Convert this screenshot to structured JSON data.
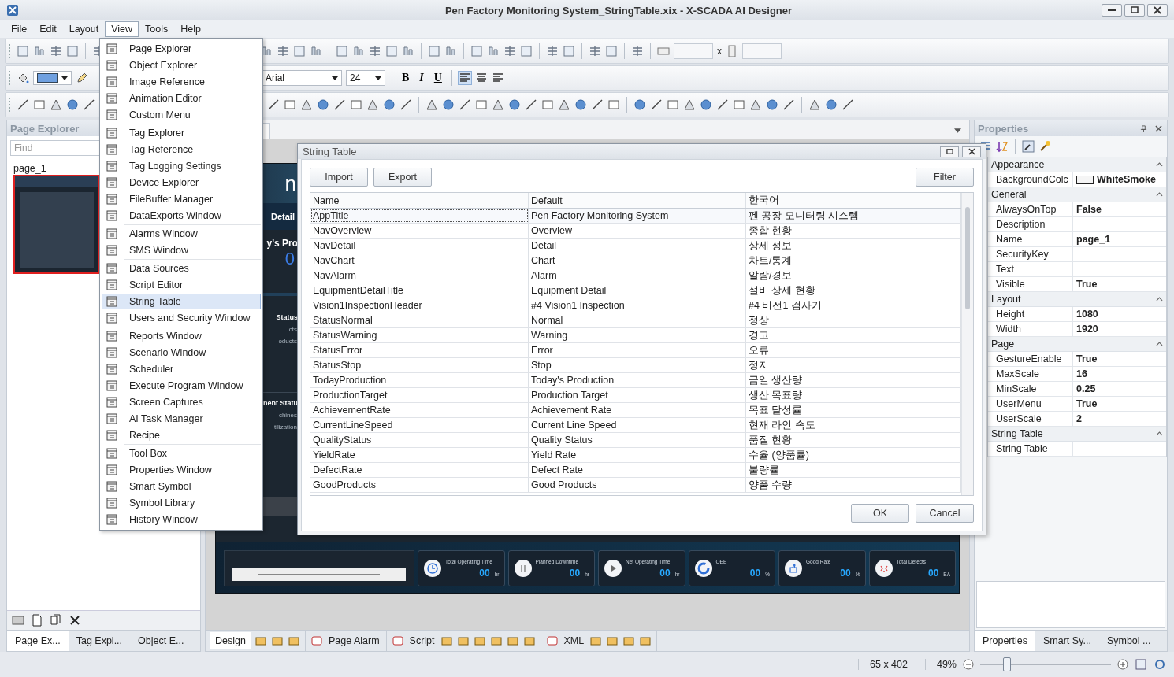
{
  "window": {
    "title": "Pen Factory Monitoring System_StringTable.xix - X-SCADA AI Designer"
  },
  "menu": [
    {
      "label": "File",
      "selected": false
    },
    {
      "label": "Edit",
      "selected": false
    },
    {
      "label": "Layout",
      "selected": false
    },
    {
      "label": "View",
      "selected": true
    },
    {
      "label": "Tools",
      "selected": false
    },
    {
      "label": "Help",
      "selected": false
    }
  ],
  "view_menu": {
    "groups": [
      [
        {
          "label": "Page Explorer",
          "selected": false
        },
        {
          "label": "Object Explorer",
          "selected": false
        },
        {
          "label": "Image Reference",
          "selected": false
        },
        {
          "label": "Animation Editor",
          "selected": false
        },
        {
          "label": "Custom Menu",
          "selected": false
        }
      ],
      [
        {
          "label": "Tag Explorer",
          "selected": false
        },
        {
          "label": "Tag Reference",
          "selected": false
        },
        {
          "label": "Tag Logging Settings",
          "selected": false
        },
        {
          "label": "Device Explorer",
          "selected": false
        },
        {
          "label": "FileBuffer Manager",
          "selected": false
        },
        {
          "label": "DataExports Window",
          "selected": false
        }
      ],
      [
        {
          "label": "Alarms Window",
          "selected": false
        },
        {
          "label": "SMS Window",
          "selected": false
        }
      ],
      [
        {
          "label": "Data Sources",
          "selected": false
        },
        {
          "label": "Script Editor",
          "selected": false
        },
        {
          "label": "String Table",
          "selected": true
        },
        {
          "label": "Users and Security Window",
          "selected": false
        }
      ],
      [
        {
          "label": "Reports Window",
          "selected": false
        },
        {
          "label": "Scenario Window",
          "selected": false
        },
        {
          "label": "Scheduler",
          "selected": false
        },
        {
          "label": "Execute Program Window",
          "selected": false
        },
        {
          "label": "Screen Captures",
          "selected": false
        },
        {
          "label": "AI Task Manager",
          "selected": false
        },
        {
          "label": "Recipe",
          "selected": false
        }
      ],
      [
        {
          "label": "Tool Box",
          "selected": false
        },
        {
          "label": "Properties Window",
          "selected": false
        },
        {
          "label": "Smart Symbol",
          "selected": false
        },
        {
          "label": "Symbol Library",
          "selected": false
        },
        {
          "label": "History Window",
          "selected": false
        }
      ]
    ]
  },
  "toolbar": {
    "size_separator": "x",
    "font": "Arial",
    "font_size": "24",
    "format_buttons": [
      "B",
      "I",
      "U"
    ]
  },
  "page_explorer": {
    "title": "Page Explorer",
    "find_placeholder": "Find",
    "pages": [
      {
        "label": "page_1",
        "selected": true
      }
    ],
    "tabs": [
      {
        "label": "Page Ex...",
        "selected": true
      },
      {
        "label": "Tag Expl...",
        "selected": false
      },
      {
        "label": "Object E...",
        "selected": false
      }
    ]
  },
  "design_page": {
    "title_fragment": "n",
    "nav_fragment": "Detail",
    "production_heading": "y's Pro",
    "production_value": "0",
    "status_heading": "Status",
    "status_lines": [
      "cts",
      "oducts"
    ],
    "equipment_heading": "nent Statu",
    "equipment_lines": [
      "chines",
      "tilization"
    ],
    "kpis": [
      {
        "title": "Total Operating Time",
        "value": "00",
        "unit": "hr"
      },
      {
        "title": "Planned Downtime",
        "value": "00",
        "unit": "hr"
      },
      {
        "title": "Net Operating Time",
        "value": "00",
        "unit": "hr"
      },
      {
        "title": "OEE",
        "value": "00",
        "unit": "%"
      },
      {
        "title": "Good Rate",
        "value": "00",
        "unit": "%"
      },
      {
        "title": "Total Defects",
        "value": "00",
        "unit": "EA"
      }
    ]
  },
  "string_table": {
    "title": "String Table",
    "buttons": [
      "Import",
      "Export"
    ],
    "filter": "Filter",
    "columns": [
      "Name",
      "Default",
      "한국어"
    ],
    "rows": [
      {
        "cells": [
          "AppTitle",
          "Pen Factory Monitoring System",
          "펜 공장 모니터링 시스템"
        ],
        "selected": true
      },
      {
        "cells": [
          "NavOverview",
          "Overview",
          "종합 현황"
        ],
        "selected": false
      },
      {
        "cells": [
          "NavDetail",
          "Detail",
          "상세 정보"
        ],
        "selected": false
      },
      {
        "cells": [
          "NavChart",
          "Chart",
          "차트/통계"
        ],
        "selected": false
      },
      {
        "cells": [
          "NavAlarm",
          "Alarm",
          "알람/경보"
        ],
        "selected": false
      },
      {
        "cells": [
          "EquipmentDetailTitle",
          "Equipment Detail",
          "설비 상세 현황"
        ],
        "selected": false
      },
      {
        "cells": [
          "Vision1InspectionHeader",
          "#4 Vision1 Inspection",
          "#4 비전1 검사기"
        ],
        "selected": false
      },
      {
        "cells": [
          "StatusNormal",
          "Normal",
          "정상"
        ],
        "selected": false
      },
      {
        "cells": [
          "StatusWarning",
          "Warning",
          "경고"
        ],
        "selected": false
      },
      {
        "cells": [
          "StatusError",
          "Error",
          "오류"
        ],
        "selected": false
      },
      {
        "cells": [
          "StatusStop",
          "Stop",
          "정지"
        ],
        "selected": false
      },
      {
        "cells": [
          "TodayProduction",
          "Today's Production",
          "금일 생산량"
        ],
        "selected": false
      },
      {
        "cells": [
          "ProductionTarget",
          "Production Target",
          "생산 목표량"
        ],
        "selected": false
      },
      {
        "cells": [
          "AchievementRate",
          "Achievement Rate",
          "목표 달성률"
        ],
        "selected": false
      },
      {
        "cells": [
          "CurrentLineSpeed",
          "Current Line Speed",
          "현재 라인 속도"
        ],
        "selected": false
      },
      {
        "cells": [
          "QualityStatus",
          "Quality Status",
          "품질 현황"
        ],
        "selected": false
      },
      {
        "cells": [
          "YieldRate",
          "Yield Rate",
          "수율 (양품률)"
        ],
        "selected": false
      },
      {
        "cells": [
          "DefectRate",
          "Defect Rate",
          "불량률"
        ],
        "selected": false
      },
      {
        "cells": [
          "GoodProducts",
          "Good Products",
          "양품 수량"
        ],
        "selected": false
      }
    ],
    "ok": "OK",
    "cancel": "Cancel"
  },
  "document_tabs": [
    {
      "label": "Design",
      "selected": true
    },
    {
      "label": "Page Alarm",
      "selected": false
    },
    {
      "label": "Script",
      "selected": false
    },
    {
      "label": "XML",
      "selected": false
    }
  ],
  "properties": {
    "title": "Properties",
    "categories": [
      {
        "name": "Appearance",
        "expanded": true,
        "items": [
          {
            "name": "BackgroundColc",
            "value": "WhiteSmoke",
            "kind": "color"
          }
        ]
      },
      {
        "name": "General",
        "expanded": true,
        "items": [
          {
            "name": "AlwaysOnTop",
            "value": "False",
            "kind": "text"
          },
          {
            "name": "Description",
            "kind": "text"
          },
          {
            "name": "Name",
            "value": "page_1",
            "kind": "text"
          },
          {
            "name": "SecurityKey",
            "kind": "text"
          },
          {
            "name": "Text",
            "kind": "text"
          },
          {
            "name": "Visible",
            "value": "True",
            "kind": "text"
          }
        ]
      },
      {
        "name": "Layout",
        "expanded": true,
        "items": [
          {
            "name": "Height",
            "value": "1080",
            "kind": "text"
          },
          {
            "name": "Width",
            "value": "1920",
            "kind": "text"
          }
        ]
      },
      {
        "name": "Page",
        "expanded": true,
        "items": [
          {
            "name": "GestureEnable",
            "value": "True",
            "kind": "text"
          },
          {
            "name": "MaxScale",
            "value": "16",
            "kind": "text"
          },
          {
            "name": "MinScale",
            "value": "0.25",
            "kind": "text"
          },
          {
            "name": "UserMenu",
            "value": "True",
            "kind": "text"
          },
          {
            "name": "UserScale",
            "value": "2",
            "kind": "text"
          }
        ]
      },
      {
        "name": "String Table",
        "expanded": true,
        "items": [
          {
            "name": "String Table",
            "kind": "text"
          }
        ]
      }
    ],
    "tabs": [
      {
        "label": "Properties",
        "selected": true
      },
      {
        "label": "Smart Sy...",
        "selected": false
      },
      {
        "label": "Symbol ...",
        "selected": false
      }
    ]
  },
  "status_bar": {
    "size": "65 x 402",
    "zoom": "49%",
    "zoom_slider": {
      "level": 0.2
    }
  }
}
